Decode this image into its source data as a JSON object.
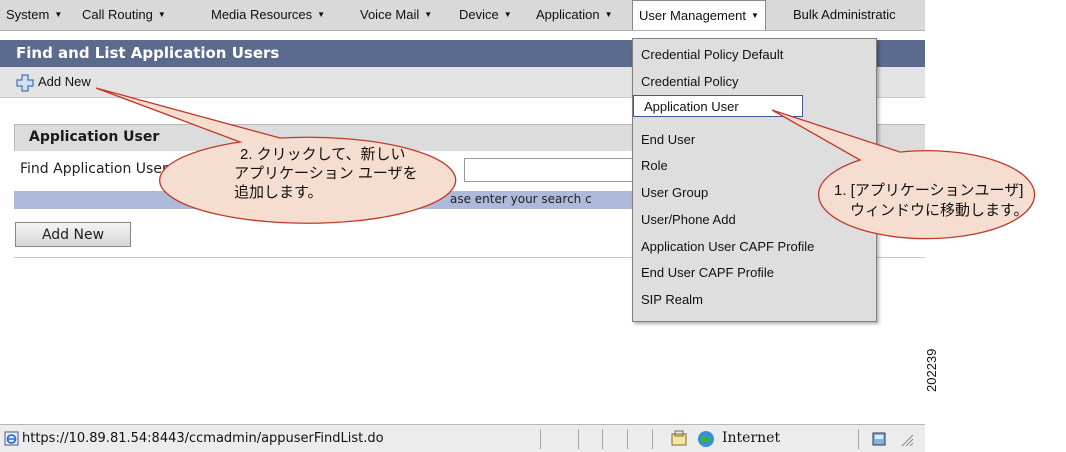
{
  "menubar": {
    "items": [
      {
        "label": "System"
      },
      {
        "label": "Call Routing"
      },
      {
        "label": "Media Resources"
      },
      {
        "label": "Voice Mail"
      },
      {
        "label": "Device"
      },
      {
        "label": "Application"
      },
      {
        "label": "User Management"
      },
      {
        "label": "Bulk Administratic"
      }
    ]
  },
  "page": {
    "title": "Find and List Application Users",
    "toolbar_add_label": "Add New"
  },
  "search": {
    "section_title": "Application User",
    "find_label": "Find Application User",
    "hint": "ase enter your search c",
    "add_button": "Add New"
  },
  "dropdown": {
    "items": [
      {
        "label": "Credential Policy Default"
      },
      {
        "label": "Credential Policy"
      },
      {
        "label": "Application User",
        "selected": true
      },
      {
        "label": "End User"
      },
      {
        "label": "Role"
      },
      {
        "label": "User Group"
      },
      {
        "label": "User/Phone Add"
      },
      {
        "label": "Application User CAPF Profile"
      },
      {
        "label": "End User CAPF Profile"
      },
      {
        "label": "SIP Realm"
      }
    ]
  },
  "status": {
    "url": "https://10.89.81.54:8443/ccmadmin/appuserFindList.do",
    "zone": "Internet"
  },
  "callouts": {
    "left": {
      "line1": "2. クリックして、新しい",
      "line2": "アプリケーション ユーザを",
      "line3": "追加します。"
    },
    "right": {
      "line1": "1. [アプリケーションユーザ]",
      "line2": "ウィンドウに移動します。"
    }
  },
  "figure_id": "202239"
}
